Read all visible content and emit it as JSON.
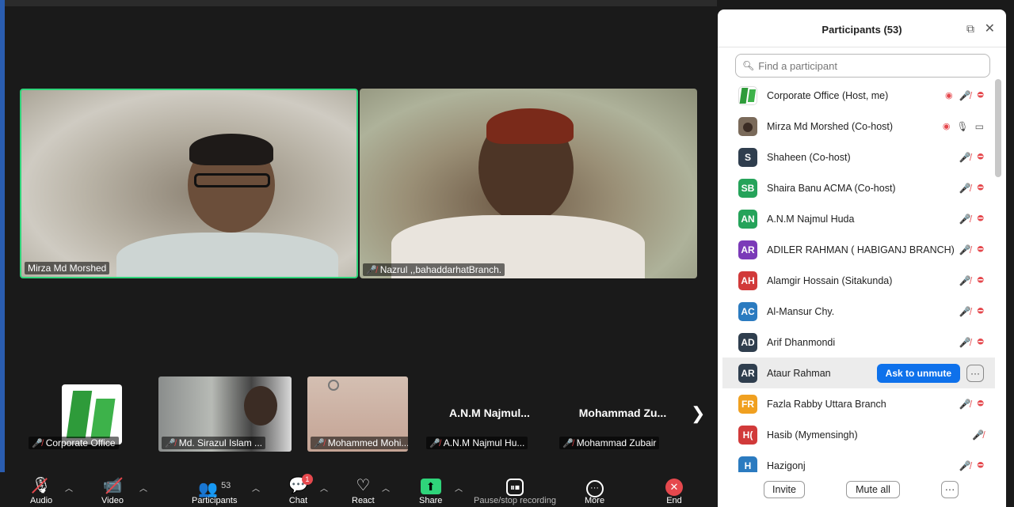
{
  "main_videos": [
    {
      "name": "Mirza Md Morshed",
      "muted": false
    },
    {
      "name": "Nazrul ,,bahaddarhatBranch.",
      "muted": true
    }
  ],
  "thumbnails": [
    {
      "name": "Corporate Office",
      "label": ""
    },
    {
      "name": "Md. Sirazul Islam ...",
      "label": ""
    },
    {
      "name": "Mohammed Mohi...",
      "label": ""
    },
    {
      "name": "A.N.M Najmul Hu...",
      "label": "A.N.M  Najmul..."
    },
    {
      "name": "Mohammad Zubair",
      "label": "Mohammad  Zu..."
    }
  ],
  "toolbar": {
    "audio": "Audio",
    "video": "Video",
    "participants": "Participants",
    "participants_count": "53",
    "chat": "Chat",
    "chat_badge": "1",
    "react": "React",
    "share": "Share",
    "recording": "Pause/stop recording",
    "more": "More",
    "end": "End"
  },
  "panel": {
    "title": "Participants (53)",
    "search_placeholder": "Find a participant",
    "invite": "Invite",
    "mute_all": "Mute all",
    "more": "···",
    "participants": [
      {
        "initials": "",
        "name": "Corporate Office (Host, me)",
        "color": "#ffffff",
        "recording": true,
        "mic": "muted",
        "cam": "off"
      },
      {
        "initials": "",
        "name": "Mirza Md Morshed (Co-host)",
        "color": "#7a6a5a",
        "recording": true,
        "mic": "on",
        "cam": "on"
      },
      {
        "initials": "S",
        "name": "Shaheen (Co-host)",
        "color": "#2f3e4e",
        "mic": "muted",
        "cam": "off"
      },
      {
        "initials": "SB",
        "name": "Shaira Banu ACMA (Co-host)",
        "color": "#25a35a",
        "mic": "muted",
        "cam": "off"
      },
      {
        "initials": "AN",
        "name": "A.N.M Najmul Huda",
        "color": "#25a35a",
        "mic": "muted",
        "cam": "off"
      },
      {
        "initials": "AR",
        "name": "ADILER RAHMAN ( HABIGANJ BRANCH)",
        "color": "#7b3ab8",
        "mic": "muted",
        "cam": "off"
      },
      {
        "initials": "AH",
        "name": "Alamgir Hossain (Sitakunda)",
        "color": "#d13a3a",
        "mic": "muted",
        "cam": "off"
      },
      {
        "initials": "AC",
        "name": "Al-Mansur Chy.",
        "color": "#2b7bc0",
        "mic": "muted",
        "cam": "off"
      },
      {
        "initials": "AD",
        "name": "Arif Dhanmondi",
        "color": "#2f3e4e",
        "mic": "muted",
        "cam": "off"
      },
      {
        "initials": "AR",
        "name": "Ataur Rahman",
        "color": "#2f3e4e",
        "highlight": true,
        "action": "Ask to unmute",
        "more": "···"
      },
      {
        "initials": "FR",
        "name": "Fazla Rabby Uttara Branch",
        "color": "#f0a020",
        "mic": "muted",
        "cam": "off"
      },
      {
        "initials": "H(",
        "name": "Hasib (Mymensingh)",
        "color": "#d13a3a",
        "mic": "muted",
        "cam": "none"
      },
      {
        "initials": "H",
        "name": "Hazigonj",
        "color": "#2b7bc0",
        "mic": "muted",
        "cam": "off"
      }
    ]
  },
  "colors": {
    "active_speaker": "#2fd47a",
    "muted_red": "#e5484d",
    "primary_blue": "#0e71eb"
  },
  "icons": {
    "mic_muted": "mic-off-icon",
    "cam_off": "camera-off-icon",
    "record": "record-icon",
    "next": "chevron-right-icon"
  }
}
